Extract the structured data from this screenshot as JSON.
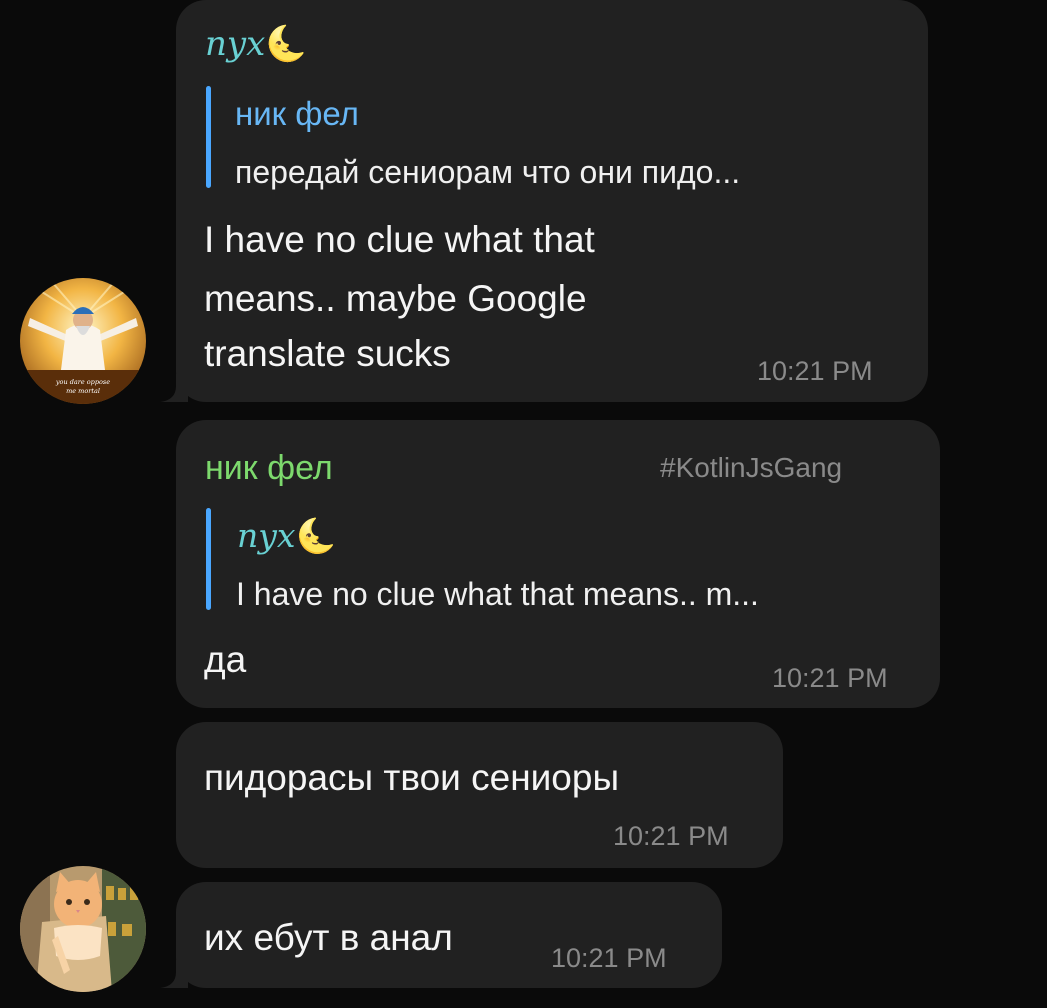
{
  "messages": [
    {
      "sender": "nyx",
      "sender_emoji": "🌜",
      "reply": {
        "name": "ник фел",
        "text": "передай сениорам что они пидо..."
      },
      "text_lines": [
        "I have no clue what that",
        "means.. maybe Google",
        "translate sucks"
      ],
      "time": "10:21 PM"
    },
    {
      "sender": "ник фел",
      "tag": "#KotlinJsGang",
      "reply": {
        "name": "nyx",
        "name_emoji": "🌜",
        "text": "I have no clue what that means.. m..."
      },
      "text": "да",
      "time": "10:21 PM"
    },
    {
      "text": "пидорасы твои сениоры",
      "time": "10:21 PM"
    },
    {
      "text": "их ебут в анал",
      "time": "10:21 PM"
    }
  ],
  "avatars": {
    "first_caption_line1": "you dare oppose",
    "first_caption_line2": "me mortal"
  },
  "colors": {
    "background": "#0a0a0a",
    "bubble": "#212121",
    "reply_bar": "#4aa7ff",
    "nyx_name": "#69d1d3",
    "nik_name": "#7dd96d",
    "reply_name_blue": "#68b7f5",
    "time": "#8a8a8a"
  }
}
